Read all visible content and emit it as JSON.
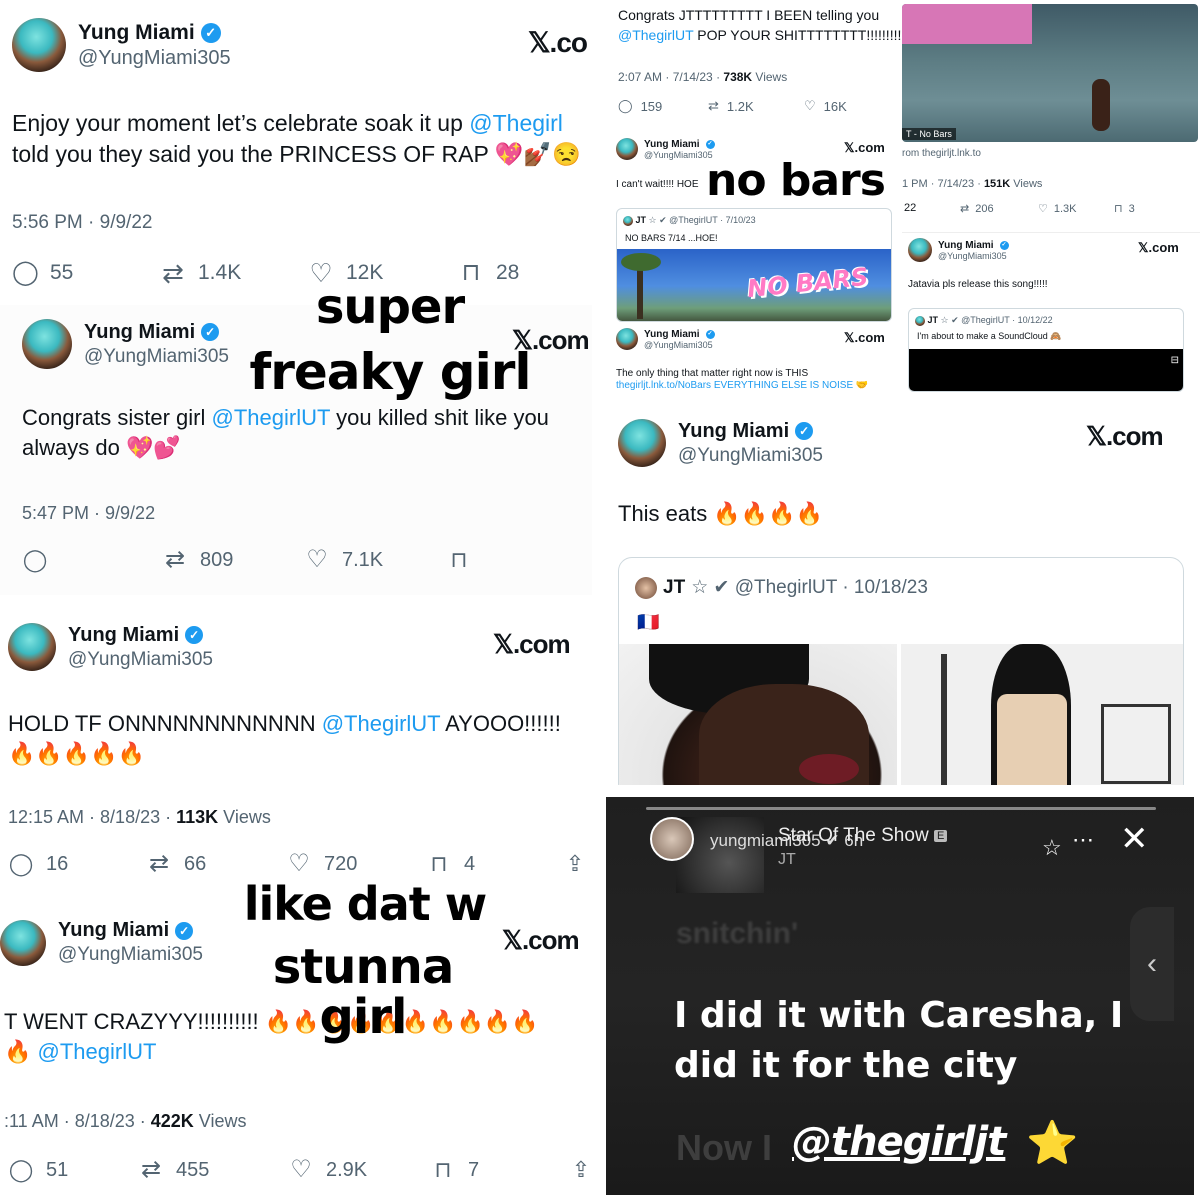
{
  "tweet1": {
    "name": "Yung Miami",
    "handle": "@YungMiami305",
    "xcom": "𝕏.co",
    "text_a": "Enjoy your moment  let’s celebrate soak it up ",
    "mention": "@Thegirl",
    "text_b": "told you they said you the PRINCESS OF RAP 💖💅🏾😒",
    "time": "5:56 PM · 9/9/22",
    "replies": "55",
    "retweets": "1.4K",
    "likes": "12K",
    "bookmarks": "28"
  },
  "tweet2": {
    "name": "Yung Miami",
    "handle": "@YungMiami305",
    "xcom": "𝕏.com",
    "text_a": "Congrats sister girl ",
    "mention": "@ThegirlUT",
    "text_b": " you killed shit like you",
    "text_c": "always do 💖💕",
    "time": "5:47 PM · 9/9/22",
    "retweets": "809",
    "likes": "7.1K"
  },
  "caption_super": "super",
  "caption_freaky": "freaky girl",
  "tweet3": {
    "name": "Yung Miami",
    "handle": "@YungMiami305",
    "xcom": "𝕏.com",
    "text_a": "HOLD TF ONNNNNNNNNNNN ",
    "mention": "@ThegirlUT",
    "text_b": " AYOOO!!!!!!",
    "emoji": "🔥🔥🔥🔥🔥",
    "time": "12:15 AM · 8/18/23 · ",
    "views": "113K",
    "views_label": " Views",
    "replies": "16",
    "retweets": "66",
    "likes": "720",
    "bookmarks": "4"
  },
  "caption_like": "like dat w",
  "caption_stunna": "stunna girl",
  "tweet4": {
    "name": "Yung Miami",
    "handle": "@YungMiami305",
    "xcom": "𝕏.com",
    "text_a": "T WENT CRAZYYY!!!!!!!!!! 🔥🔥🔥🔥🔥🔥🔥🔥🔥🔥",
    "text_b": "🔥 ",
    "mention": "@ThegirlUT",
    "time": ":11 AM · 8/18/23 · ",
    "views": "422K",
    "views_label": " Views",
    "replies": "51",
    "retweets": "455",
    "likes": "2.9K",
    "bookmarks": "7"
  },
  "tr": {
    "text_a": "Congrats JTTTTTTTTT I BEEN telling you",
    "mention": "@ThegirlUT",
    "text_b": " POP YOUR SHITTTTTTTT!!!!!!!!!",
    "time": "2:07 AM · 7/14/23 · ",
    "views": "738K",
    "views_label": " Views",
    "replies": "159",
    "retweets": "1.2K",
    "likes": "16K",
    "video_label": "T - No Bars",
    "link": "rom thegirljt.lnk.to",
    "time2": "1 PM · 7/14/23 · ",
    "views2": "151K",
    "views2_label": " Views",
    "replies2": "22",
    "retweets2": "206",
    "likes2": "1.3K",
    "bookmarks2": "3"
  },
  "mini1": {
    "name": "Yung Miami",
    "handle": "@YungMiami305",
    "xcom": "𝕏.com",
    "text": "I can't wait!!!! HOE",
    "caption": "no bars",
    "quote_name": "JT",
    "quote_meta": "☆ ✔ @ThegirlUT · 7/10/23",
    "quote_text": "NO BARS 7/14 ...HOE!",
    "art": "NO BARS"
  },
  "mini2": {
    "name": "Yung Miami",
    "handle": "@YungMiami305",
    "xcom": "𝕏.com",
    "text": "The only thing that matter right now is THIS",
    "link": "thegirljt.lnk.to/NoBars EVERYTHING ELSE IS NOISE 🤝"
  },
  "mini3": {
    "name": "Yung Miami",
    "handle": "@YungMiami305",
    "xcom": "𝕏.com",
    "text": "Jatavia pls release this song!!!!!",
    "quote_name": "JT",
    "quote_meta": "☆ ✔ @ThegirlUT · 10/12/22",
    "quote_text": "I'm about to make a SoundCloud 🙈",
    "play": "⊟"
  },
  "tweet5": {
    "name": "Yung Miami",
    "handle": "@YungMiami305",
    "xcom": "𝕏.com",
    "text": "This eats 🔥🔥🔥🔥",
    "quote_name": "JT",
    "quote_meta": "☆ ✔ @ThegirlUT · 10/18/23",
    "flag": "🇫🇷"
  },
  "story": {
    "username": "yungmiami305 ✔ 6h",
    "song": "Star Of The Show",
    "explicit": "E",
    "artist": "JT",
    "faded1": "snitchin'",
    "line1": "I did it with Caresha, I",
    "line2": "did it for the city",
    "tag": "@thegirljt",
    "star": "⭐",
    "faded2": "Now I"
  },
  "colors": {
    "blue": "#1d9bf0",
    "gray": "#536471",
    "dark": "#1c1c1c"
  }
}
